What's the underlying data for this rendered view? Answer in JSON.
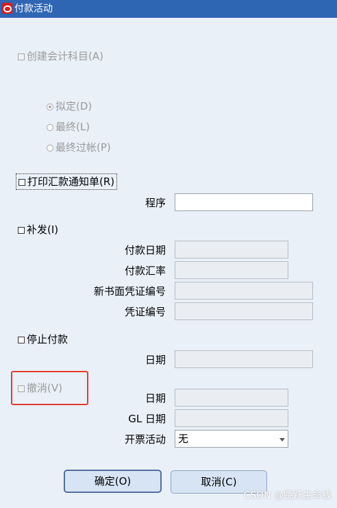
{
  "window": {
    "title": "付款活动",
    "icon": "oracle-icon"
  },
  "create_accounting": {
    "label": "创建会计科目",
    "mnemonic": "(A)",
    "checked": false,
    "enabled": false
  },
  "accounting_mode": {
    "options": [
      {
        "label": "拟定",
        "mnemonic": "(D)",
        "selected": true
      },
      {
        "label": "最终",
        "mnemonic": "(L)",
        "selected": false
      },
      {
        "label": "最终过帐",
        "mnemonic": "(P)",
        "selected": false
      }
    ]
  },
  "print_remittance": {
    "label": "打印汇款通知单",
    "mnemonic": "(R)",
    "checked": false
  },
  "program": {
    "label": "程序",
    "value": ""
  },
  "reissue": {
    "label": "补发",
    "mnemonic": "(I)",
    "checked": false,
    "payment_date_label": "付款日期",
    "payment_date_value": "",
    "payment_rate_label": "付款汇率",
    "payment_rate_value": "",
    "new_doc_seq_label": "新书面凭证编号",
    "new_doc_seq_value": "",
    "doc_seq_label": "凭证编号",
    "doc_seq_value": ""
  },
  "stop_payment": {
    "label": "停止付款",
    "checked": false,
    "date_label": "日期",
    "date_value": ""
  },
  "void": {
    "label": "撤消",
    "mnemonic": "(V)",
    "checked": false,
    "enabled": false,
    "date_label": "日期",
    "date_value": "",
    "gl_date_label": "GL 日期",
    "gl_date_value": "",
    "invoice_action_label": "开票活动",
    "invoice_action_value": "无"
  },
  "buttons": {
    "ok": "确定(O)",
    "cancel": "取消(C)"
  },
  "watermark": "CSDN @跳跃生命线",
  "colors": {
    "title_bar": "#2f66b3",
    "background": "#eaf0f8",
    "highlight": "#e23b2f"
  }
}
